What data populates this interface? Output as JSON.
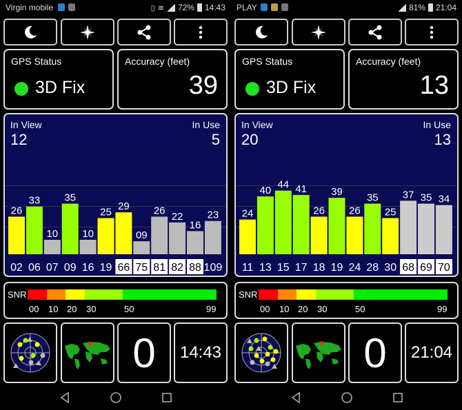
{
  "panels": [
    {
      "statusbar": {
        "carrier": "Virgin mobile",
        "battery": "72%",
        "time": "14:43"
      },
      "toolbar": {
        "night_icon": "moon-icon",
        "compass_icon": "compass-icon",
        "share_icon": "share-icon",
        "menu_icon": "more-vert-icon"
      },
      "gps_status": {
        "title": "GPS Status",
        "fix": "3D Fix"
      },
      "accuracy": {
        "title": "Accuracy (feet)",
        "value": "39"
      },
      "sky": {
        "in_view_label": "In View",
        "in_view": "12",
        "in_use_label": "In Use",
        "in_use": "5",
        "satellites": [
          {
            "id": "02",
            "snr": 26,
            "color": "#ffff00",
            "boxed": false
          },
          {
            "id": "06",
            "snr": 33,
            "color": "#99ff00",
            "boxed": false
          },
          {
            "id": "07",
            "snr": 10,
            "color": "#bbbbbb",
            "boxed": false
          },
          {
            "id": "09",
            "snr": 35,
            "color": "#99ff00",
            "boxed": false
          },
          {
            "id": "16",
            "snr": 10,
            "color": "#bbbbbb",
            "boxed": false
          },
          {
            "id": "19",
            "snr": 25,
            "color": "#ffff00",
            "boxed": false
          },
          {
            "id": "66",
            "snr": 29,
            "color": "#ffff00",
            "boxed": true
          },
          {
            "id": "75",
            "snr": "09",
            "snr_value": 9,
            "color": "#bbbbbb",
            "boxed": true
          },
          {
            "id": "81",
            "snr": 26,
            "color": "#bbbbbb",
            "boxed": true
          },
          {
            "id": "82",
            "snr": 22,
            "color": "#bbbbbb",
            "boxed": true
          },
          {
            "id": "88",
            "snr": 16,
            "color": "#bbbbbb",
            "boxed": true
          },
          {
            "id": "109",
            "snr": 23,
            "color": "#bbbbbb",
            "boxed": false
          }
        ]
      },
      "snr_legend": {
        "label": "SNR",
        "ticks": [
          "00",
          "10",
          "20",
          "30",
          "50",
          "99"
        ]
      },
      "bottom": {
        "radar_icon": "sky-radar-icon",
        "map_icon": "world-map-icon",
        "count": "0",
        "clock": "14:43"
      }
    },
    {
      "statusbar": {
        "carrier": "PLAY",
        "battery": "81%",
        "time": "21:04"
      },
      "toolbar": {
        "night_icon": "moon-icon",
        "compass_icon": "compass-icon",
        "share_icon": "share-icon",
        "menu_icon": "more-vert-icon"
      },
      "gps_status": {
        "title": "GPS Status",
        "fix": "3D Fix"
      },
      "accuracy": {
        "title": "Accuracy (feet)",
        "value": "13"
      },
      "sky": {
        "in_view_label": "In View",
        "in_view": "20",
        "in_use_label": "In Use",
        "in_use": "13",
        "satellites": [
          {
            "id": "11",
            "snr": 24,
            "color": "#ffff00",
            "boxed": false
          },
          {
            "id": "13",
            "snr": 40,
            "color": "#99ff00",
            "boxed": false
          },
          {
            "id": "15",
            "snr": 44,
            "color": "#99ff00",
            "boxed": false
          },
          {
            "id": "17",
            "snr": 41,
            "color": "#99ff00",
            "boxed": false
          },
          {
            "id": "18",
            "snr": 26,
            "color": "#ffff00",
            "boxed": false
          },
          {
            "id": "19",
            "snr": 39,
            "color": "#99ff00",
            "boxed": false
          },
          {
            "id": "24",
            "snr": 26,
            "color": "#ffff00",
            "boxed": false
          },
          {
            "id": "28",
            "snr": 35,
            "color": "#99ff00",
            "boxed": false
          },
          {
            "id": "30",
            "snr": 25,
            "color": "#ffff00",
            "boxed": false
          },
          {
            "id": "68",
            "snr": 37,
            "color": "#cccccc",
            "boxed": true
          },
          {
            "id": "69",
            "snr": 35,
            "color": "#cccccc",
            "boxed": true
          },
          {
            "id": "70",
            "snr": 34,
            "color": "#cccccc",
            "boxed": true
          }
        ]
      },
      "snr_legend": {
        "label": "SNR",
        "ticks": [
          "00",
          "10",
          "20",
          "30",
          "50",
          "99"
        ]
      },
      "bottom": {
        "radar_icon": "sky-radar-icon",
        "map_icon": "world-map-icon",
        "count": "0",
        "clock": "21:04"
      }
    }
  ],
  "navbar": {
    "back_icon": "back-triangle-icon",
    "home_icon": "home-circle-icon",
    "recents_icon": "recents-square-icon"
  },
  "colors": {
    "sky_bg": "#0a0a55",
    "fix_dot": "#22e022",
    "snr_scale": [
      "#ff0000",
      "#ff8800",
      "#ffff00",
      "#99ff00",
      "#00ee00"
    ]
  }
}
